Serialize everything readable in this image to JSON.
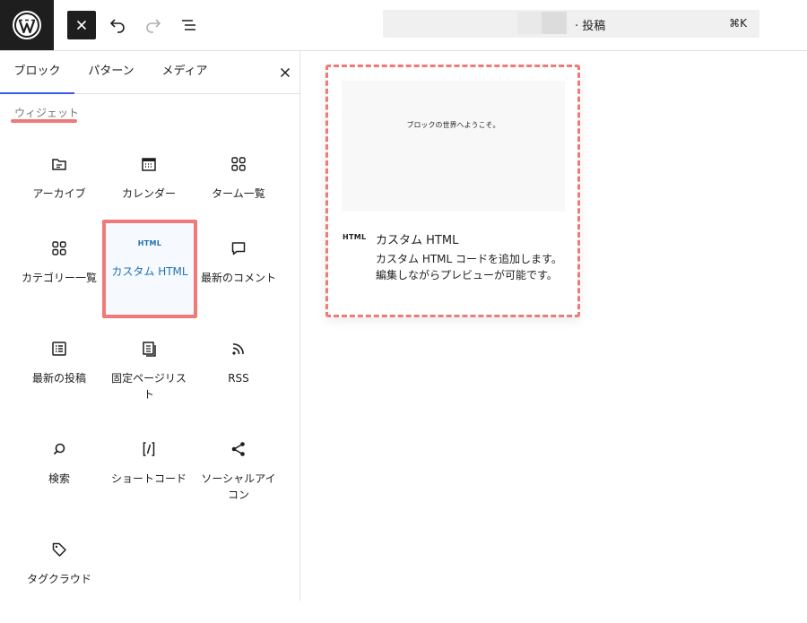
{
  "toolbar": {
    "document_title": "· 投稿",
    "shortcut": "⌘K"
  },
  "sidebar": {
    "tabs": [
      {
        "label": "ブロック"
      },
      {
        "label": "パターン"
      },
      {
        "label": "メディア"
      }
    ],
    "category": "ウィジェット",
    "blocks": [
      {
        "label": "アーカイブ",
        "icon": "archive-icon"
      },
      {
        "label": "カレンダー",
        "icon": "calendar-icon"
      },
      {
        "label": "ターム一覧",
        "icon": "grid-icon"
      },
      {
        "label": "カテゴリー一覧",
        "icon": "categories-icon"
      },
      {
        "label": "カスタム HTML",
        "icon": "html-icon",
        "icon_text": "HTML"
      },
      {
        "label": "最新のコメント",
        "icon": "comment-icon"
      },
      {
        "label": "最新の投稿",
        "icon": "post-list-icon"
      },
      {
        "label": "固定ページリスト",
        "icon": "pages-icon"
      },
      {
        "label": "RSS",
        "icon": "rss-icon"
      },
      {
        "label": "検索",
        "icon": "search-icon"
      },
      {
        "label": "ショートコード",
        "icon": "shortcode-icon"
      },
      {
        "label": "ソーシャルアイコン",
        "icon": "share-icon"
      },
      {
        "label": "タグクラウド",
        "icon": "tag-icon"
      }
    ]
  },
  "preview": {
    "sample_text": "ブロックの世界へようこそ。",
    "icon_text": "HTML",
    "title": "カスタム HTML",
    "description": "カスタム HTML コードを追加します。編集しながらプレビューが可能です。"
  },
  "colors": {
    "accent": "#3858e9",
    "highlight": "#f0797a",
    "active_text": "#2271b1"
  }
}
